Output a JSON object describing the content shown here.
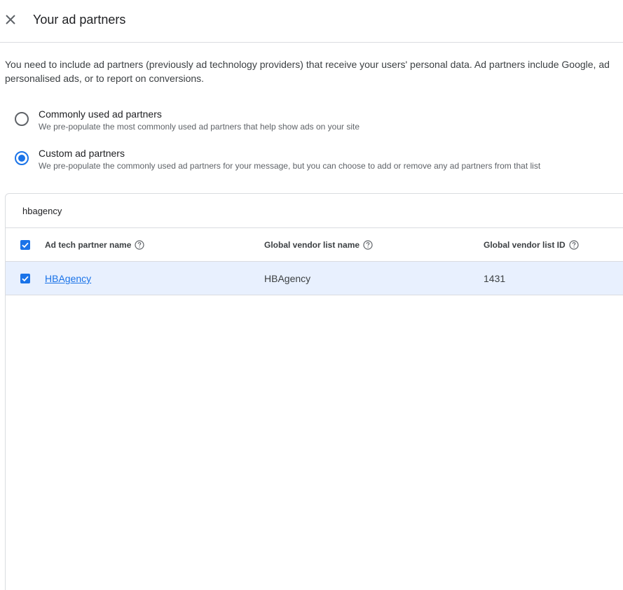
{
  "header": {
    "title": "Your ad partners",
    "close_icon": "close-icon"
  },
  "description": {
    "line1": "You need to include ad partners (previously ad technology providers) that receive your users' personal data. Ad partners include Google, ad",
    "line2": "personalised ads, or to report on conversions."
  },
  "options": [
    {
      "label": "Commonly used ad partners",
      "sub": "We pre-populate the most commonly used ad partners that help show ads on your site",
      "selected": false
    },
    {
      "label": "Custom ad partners",
      "sub": "We pre-populate the commonly used ad partners for your message, but you can choose to add or remove any ad partners from that list",
      "selected": true
    }
  ],
  "search": {
    "value": "hbagency"
  },
  "table": {
    "columns": [
      "Ad tech partner name",
      "Global vendor list name",
      "Global vendor list ID"
    ],
    "rows": [
      {
        "name": "HBAgency",
        "gvl_name": "HBAgency",
        "gvl_id": "1431",
        "checked": true
      }
    ],
    "select_all_checked": true
  },
  "colors": {
    "accent": "#1a73e8",
    "row_selected": "#e8f0fe",
    "border": "#dadce0"
  }
}
